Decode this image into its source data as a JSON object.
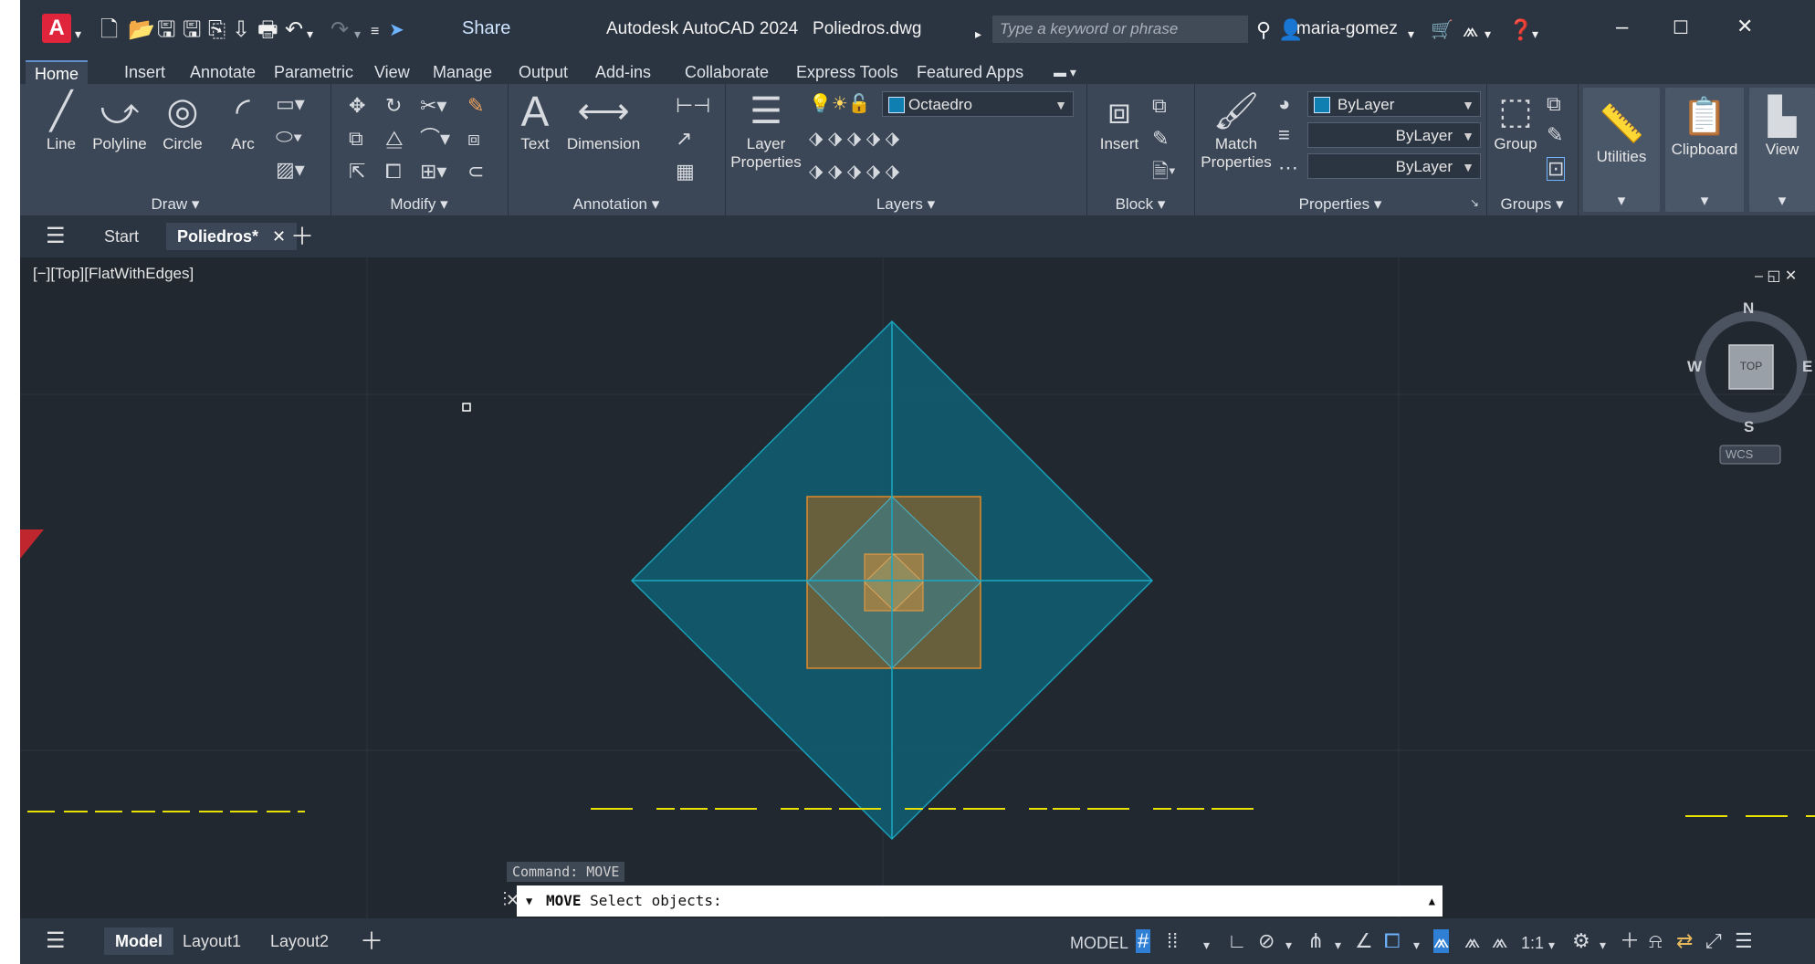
{
  "app": {
    "logo_letter": "A",
    "title": "Autodesk AutoCAD 2024",
    "file": "Poliedros.dwg",
    "share_label": "Share",
    "search_placeholder": "Type a keyword or phrase",
    "user": "maria-gomez"
  },
  "ribbon_tabs": [
    "Home",
    "Insert",
    "Annotate",
    "Parametric",
    "View",
    "Manage",
    "Output",
    "Add-ins",
    "Collaborate",
    "Express Tools",
    "Featured Apps"
  ],
  "ribbon": {
    "draw": {
      "title": "Draw",
      "line": "Line",
      "polyline": "Polyline",
      "circle": "Circle",
      "arc": "Arc"
    },
    "modify": {
      "title": "Modify"
    },
    "annotation": {
      "title": "Annotation",
      "text": "Text",
      "dimension": "Dimension"
    },
    "layers": {
      "title": "Layers",
      "layer_properties_1": "Layer",
      "layer_properties_2": "Properties",
      "current_layer": "Octaedro"
    },
    "block": {
      "title": "Block",
      "insert": "Insert"
    },
    "properties": {
      "title": "Properties",
      "match_1": "Match",
      "match_2": "Properties",
      "color": "ByLayer",
      "lineweight": "ByLayer",
      "linetype": "ByLayer"
    },
    "groups": {
      "title": "Groups",
      "group": "Group"
    },
    "utilities": "Utilities",
    "clipboard": "Clipboard",
    "view": "View"
  },
  "doc_tabs": {
    "start": "Start",
    "active": "Poliedros*"
  },
  "viewport": {
    "label": "[−][Top][FlatWithEdges]",
    "viewcube": {
      "n": "N",
      "s": "S",
      "e": "E",
      "w": "W",
      "face": "TOP",
      "ucs": "WCS"
    }
  },
  "command": {
    "history": "Command:  MOVE",
    "current_cmd": "MOVE",
    "prompt": "Select objects:"
  },
  "layout_tabs": [
    "Model",
    "Layout1",
    "Layout2"
  ],
  "status": {
    "model": "MODEL",
    "scale": "1:1"
  },
  "colors": {
    "octahedron": "#0e5e73",
    "cube": "#b06a1a",
    "background": "#212830"
  }
}
